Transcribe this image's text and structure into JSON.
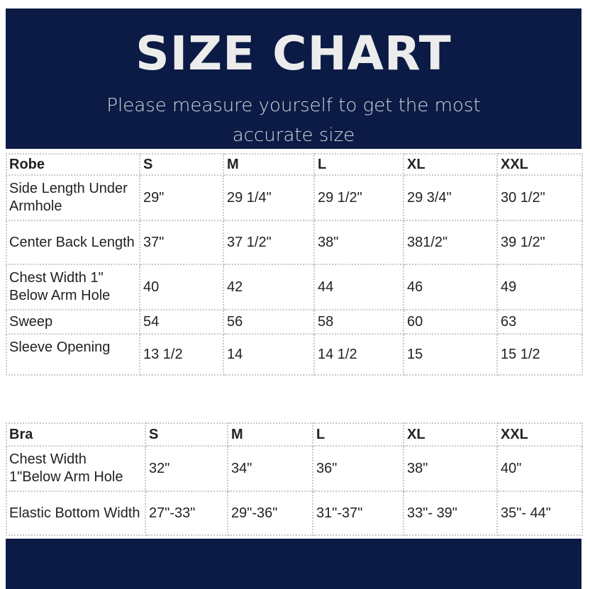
{
  "header": {
    "title": "SIZE CHART",
    "subtitle": "Please measure  yourself to get the most accurate size"
  },
  "robe": {
    "headers": [
      "Robe",
      "S",
      "M",
      "L",
      "XL",
      "XXL"
    ],
    "rows": [
      {
        "label": "Side Length Under Armhole",
        "values": [
          "29\"",
          "29 1/4\"",
          "29 1/2\"",
          "29 3/4\"",
          "30 1/2\""
        ]
      },
      {
        "label": "Center Back Length",
        "values": [
          "37\"",
          "37 1/2\"",
          "38\"",
          "381/2\"",
          "39 1/2\""
        ]
      },
      {
        "label": "Chest Width 1\" Below Arm Hole",
        "values": [
          "40",
          "42",
          "44",
          "46",
          "49"
        ]
      },
      {
        "label": "Sweep",
        "values": [
          "54",
          "56",
          "58",
          "60",
          "63"
        ]
      },
      {
        "label": "Sleeve Opening",
        "values": [
          "13 1/2",
          "14",
          "14 1/2",
          "15",
          "15 1/2"
        ]
      }
    ]
  },
  "bra": {
    "headers": [
      "Bra",
      "S",
      "M",
      "L",
      "XL",
      "XXL"
    ],
    "rows": [
      {
        "label": "Chest Width 1\"Below Arm Hole",
        "values": [
          "32\"",
          "34\"",
          "36\"",
          "38\"",
          "40\""
        ]
      },
      {
        "label": "Elastic Bottom Width",
        "values": [
          "27\"-33\"",
          "29\"-36\"",
          "31\"-37\"",
          "33\"- 39\"",
          "35\"- 44\""
        ]
      }
    ]
  },
  "colors": {
    "navy": "#0b1b45",
    "title_text": "#ececec",
    "border": "#c9c9c9",
    "text": "#222222"
  }
}
